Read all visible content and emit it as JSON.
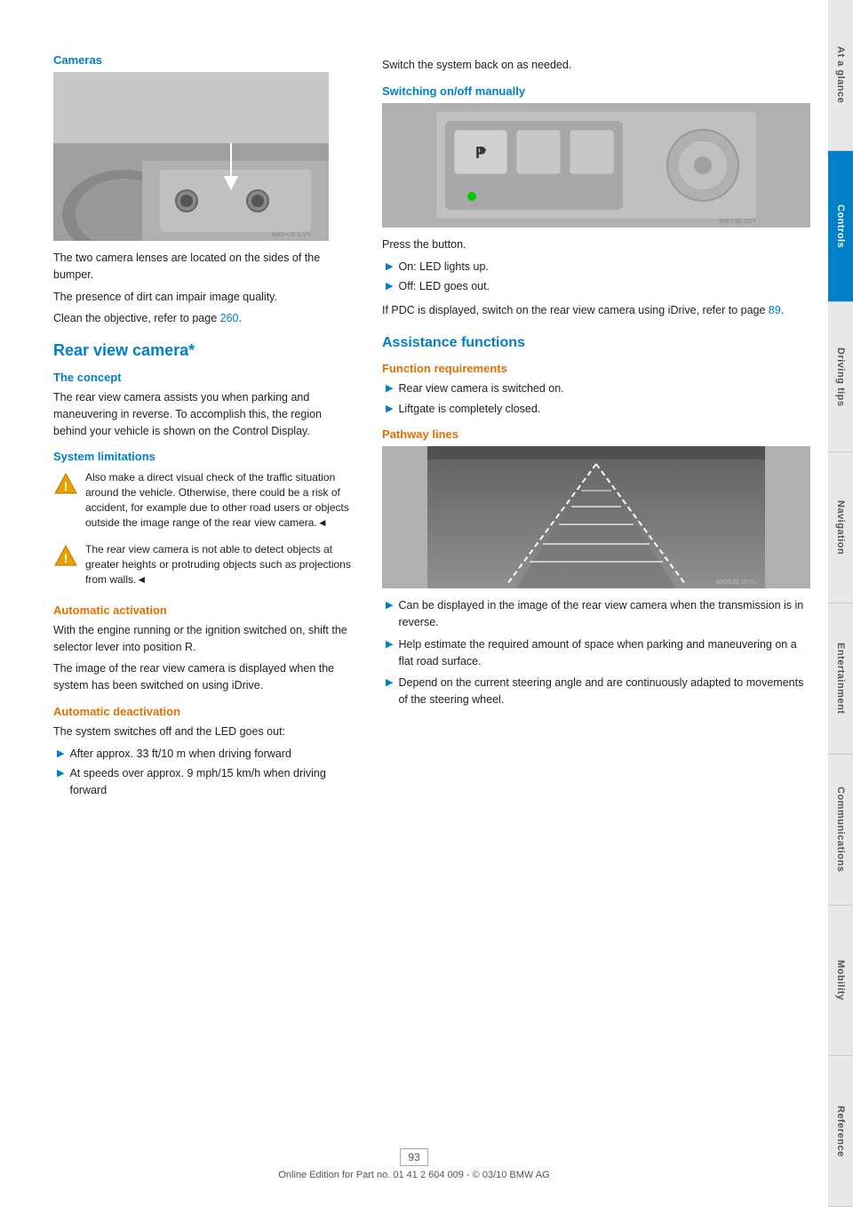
{
  "sidebar": {
    "tabs": [
      {
        "label": "At a glance",
        "active": false
      },
      {
        "label": "Controls",
        "active": true
      },
      {
        "label": "Driving tips",
        "active": false
      },
      {
        "label": "Navigation",
        "active": false
      },
      {
        "label": "Entertainment",
        "active": false
      },
      {
        "label": "Communications",
        "active": false
      },
      {
        "label": "Mobility",
        "active": false
      },
      {
        "label": "Reference",
        "active": false
      }
    ]
  },
  "left_column": {
    "cameras_heading": "Cameras",
    "cameras_para1": "The two camera lenses are located on the sides of the bumper.",
    "cameras_para2": "The presence of dirt can impair image quality.",
    "cameras_para3_prefix": "Clean the objective, refer to page ",
    "cameras_page_ref": "260",
    "cameras_para3_suffix": ".",
    "rear_view_heading": "Rear view camera*",
    "concept_heading": "The concept",
    "concept_para": "The rear view camera assists you when parking and maneuvering in reverse. To accomplish this, the region behind your vehicle is shown on the Control Display.",
    "system_limitations_heading": "System limitations",
    "warning1_text": "Also make a direct visual check of the traffic situation around the vehicle. Otherwise, there could be a risk of accident, for example due to other road users or objects outside the image range of the rear view camera.",
    "warning1_end": "◄",
    "warning2_text": "The rear view camera is not able to detect objects at greater heights or protruding objects such as projections from walls.",
    "warning2_end": "◄",
    "auto_activation_heading": "Automatic activation",
    "auto_activation_para1": "With the engine running or the ignition switched on, shift the selector lever into position R.",
    "auto_activation_para2": "The image of the rear view camera is displayed when the system has been switched on using iDrive.",
    "auto_deactivation_heading": "Automatic deactivation",
    "auto_deactivation_para": "The system switches off and the LED goes out:",
    "bullet_after": "After approx. 33 ft/10 m when driving forward",
    "bullet_speeds": "At speeds over approx. 9 mph/15 km/h when driving forward"
  },
  "right_column": {
    "switch_back": "Switch the system back on as needed.",
    "switching_heading": "Switching on/off manually",
    "press_button": "Press the button.",
    "bullet_on": "On: LED lights up.",
    "bullet_off": "Off: LED goes out.",
    "pdc_text_prefix": "If PDC is displayed, switch on the rear view camera using iDrive, refer to page ",
    "pdc_page_ref": "89",
    "pdc_text_suffix": ".",
    "assistance_heading": "Assistance functions",
    "function_req_heading": "Function requirements",
    "bullet_switched_on": "Rear view camera is switched on.",
    "bullet_liftgate": "Liftgate is completely closed.",
    "pathway_heading": "Pathway lines",
    "pathway_bullet1": "Can be displayed in the image of the rear view camera when the transmission is in reverse.",
    "pathway_bullet2": "Help estimate the required amount of space when parking and maneuvering on a flat road surface.",
    "pathway_bullet3": "Depend on the current steering angle and are continuously adapted to movements of the steering wheel."
  },
  "footer": {
    "page_number": "93",
    "footer_text": "Online Edition for Part no. 01 41 2 604 009 - © 03/10 BMW AG"
  }
}
